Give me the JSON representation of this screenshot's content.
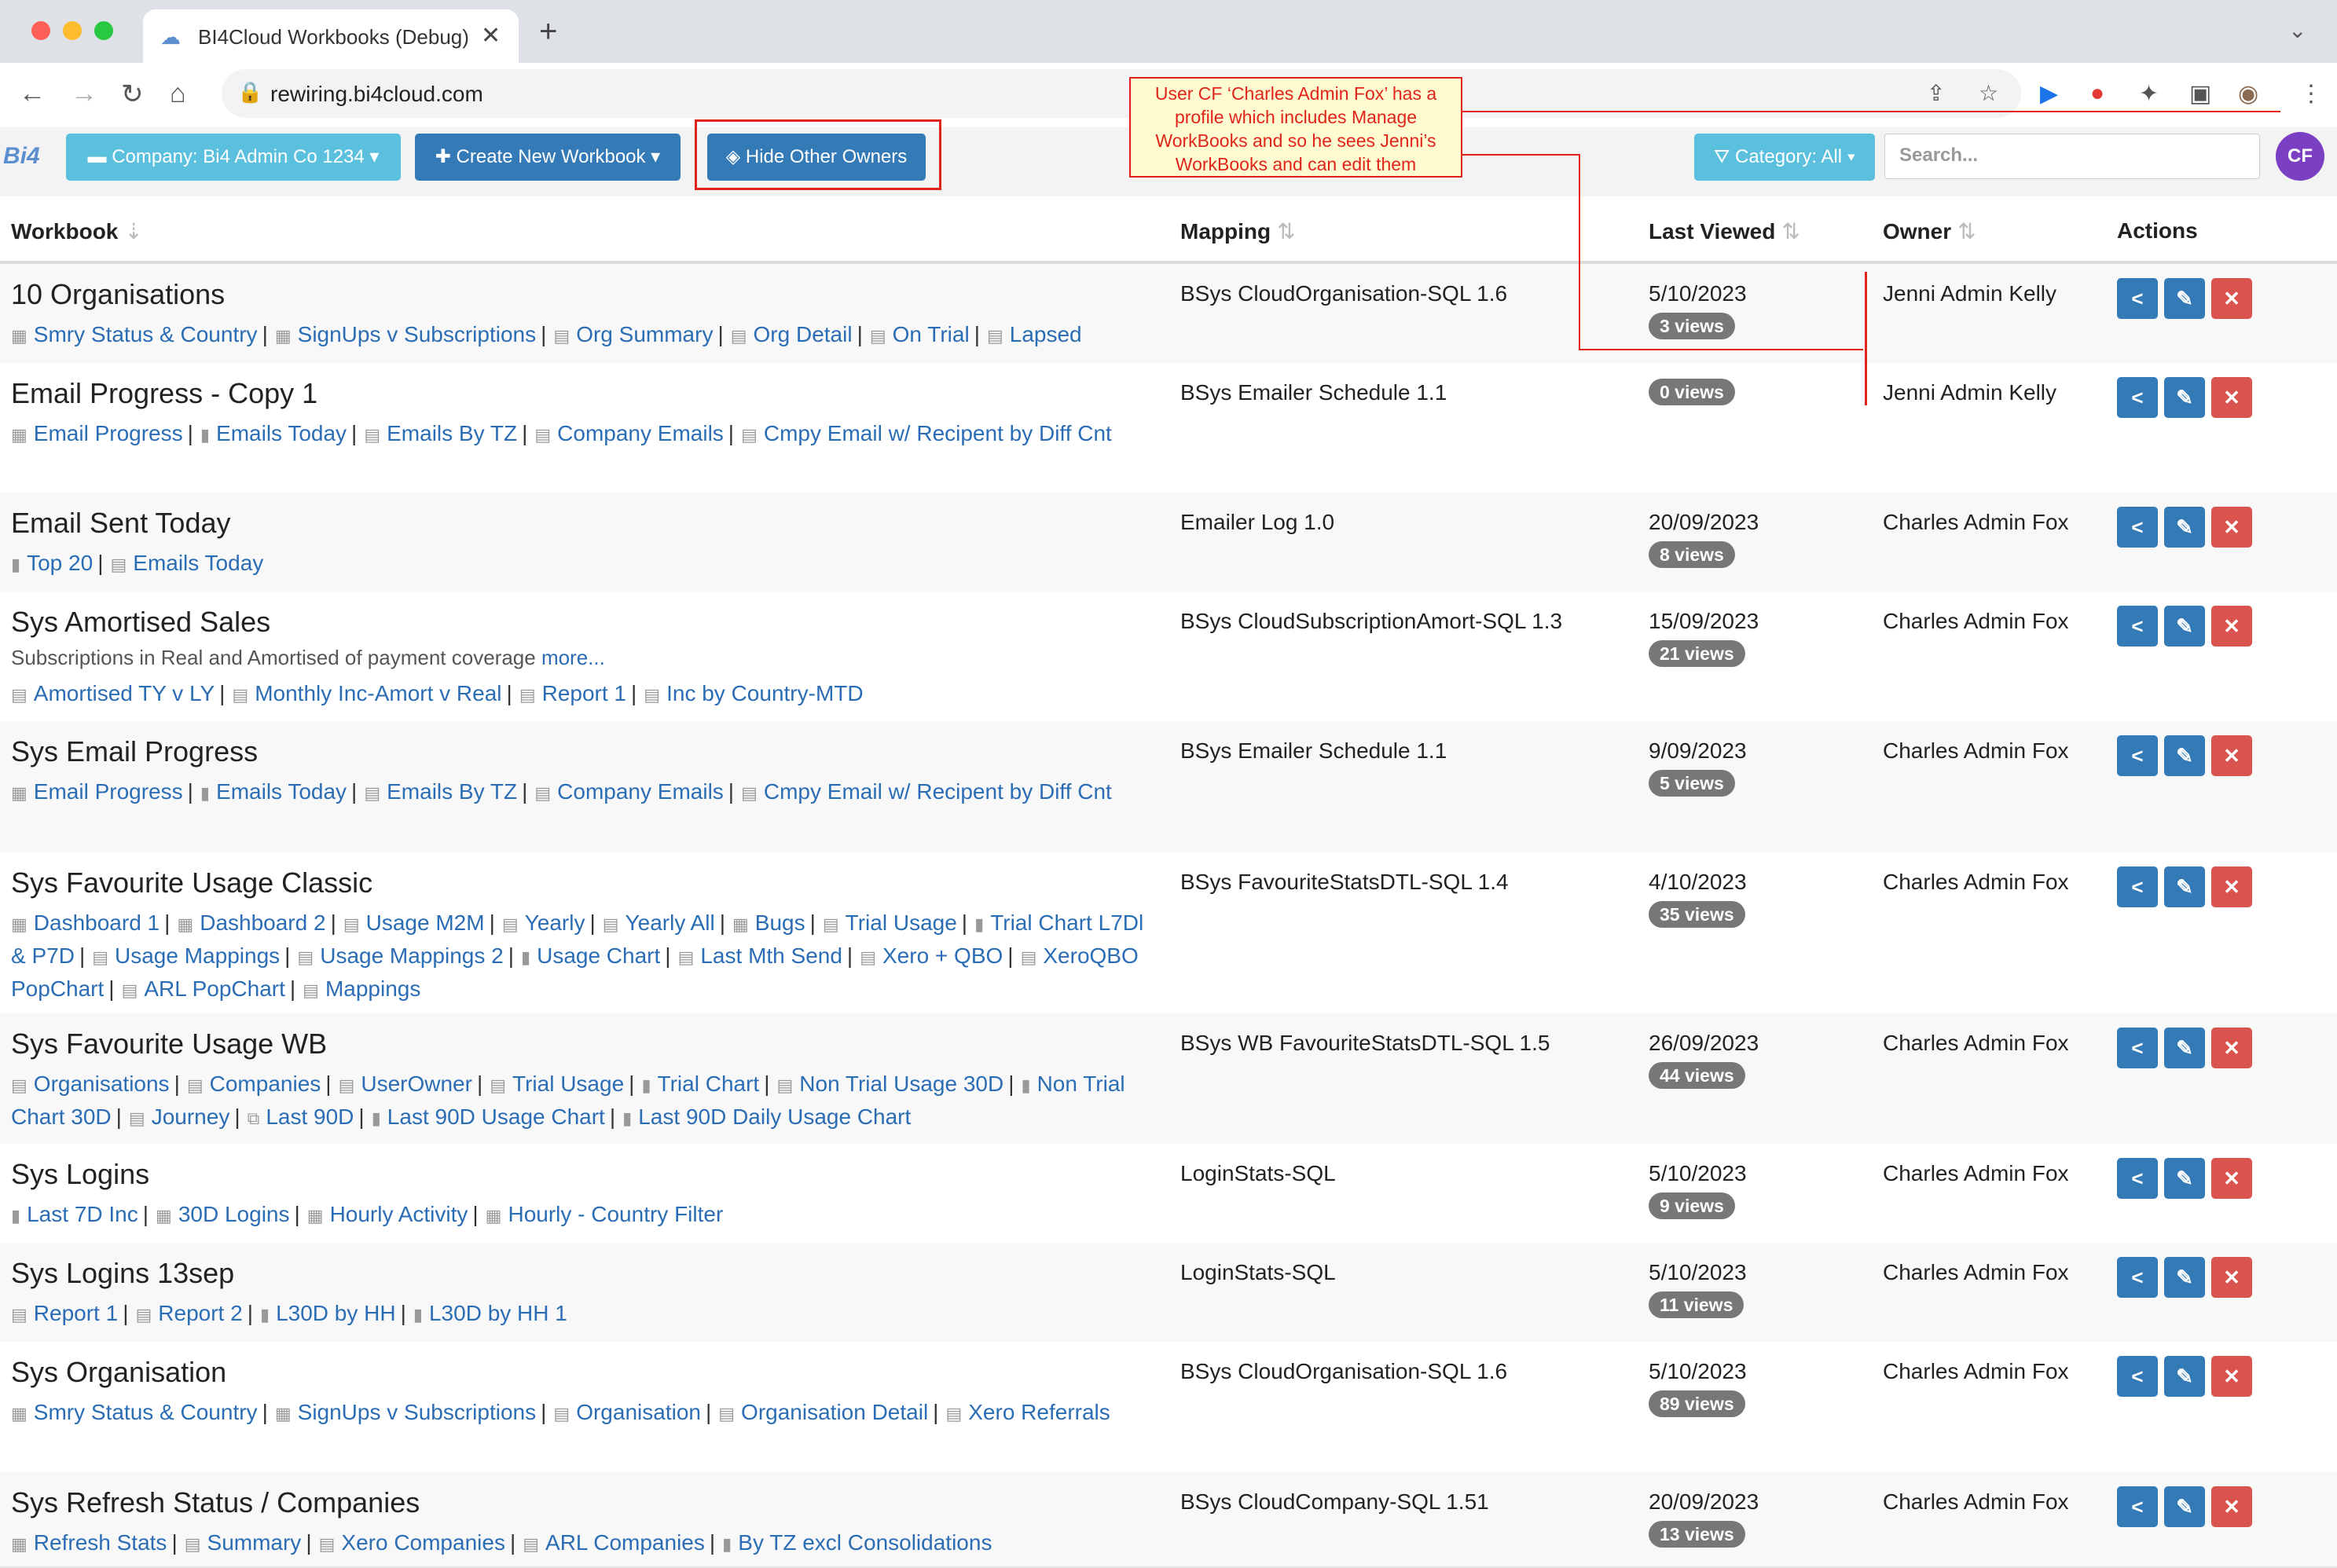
{
  "browser": {
    "tab_title": "BI4Cloud Workbooks (Debug)",
    "url": "rewiring.bi4cloud.com"
  },
  "toolbar": {
    "logo": "Bi4",
    "company_label": "Company: Bi4 Admin Co 1234",
    "create_label": "Create New Workbook",
    "hide_label": "Hide Other Owners",
    "category_label": "Category: All",
    "search_placeholder": "Search...",
    "avatar_initials": "CF"
  },
  "callout": {
    "text": "User CF ‘Charles Admin Fox’ has a profile which includes Manage WorkBooks and so he sees Jenni’s WorkBooks and can edit them"
  },
  "table": {
    "headers": {
      "workbook": "Workbook",
      "mapping": "Mapping",
      "last_viewed": "Last Viewed",
      "owner": "Owner",
      "actions": "Actions"
    },
    "rows": [
      {
        "name": "10 Organisations",
        "mapping": "BSys CloudOrganisation-SQL 1.6",
        "last_viewed": "5/10/2023",
        "views": "3 views",
        "owner": "Jenni Admin Kelly",
        "sheets": [
          {
            "t": "Smry Status & Country",
            "i": "dash"
          },
          {
            "t": "SignUps v Subscriptions",
            "i": "dash"
          },
          {
            "t": "Org Summary",
            "i": "rep"
          },
          {
            "t": "Org Detail",
            "i": "rep"
          },
          {
            "t": "On Trial",
            "i": "rep"
          },
          {
            "t": "Lapsed",
            "i": "rep"
          }
        ]
      },
      {
        "name": "Email Progress - Copy 1",
        "mapping": "BSys Emailer Schedule 1.1",
        "last_viewed": "",
        "views": "0 views",
        "owner": "Jenni Admin Kelly",
        "sheets": [
          {
            "t": "Email Progress",
            "i": "dash"
          },
          {
            "t": "Emails Today",
            "i": "chart"
          },
          {
            "t": "Emails By TZ",
            "i": "rep"
          },
          {
            "t": "Company Emails",
            "i": "rep"
          },
          {
            "t": "Cmpy Email w/ Recipent by Diff Cnt",
            "i": "rep"
          }
        ]
      },
      {
        "name": "Email Sent Today",
        "mapping": "Emailer Log 1.0",
        "last_viewed": "20/09/2023",
        "views": "8 views",
        "owner": "Charles Admin Fox",
        "sheets": [
          {
            "t": "Top 20",
            "i": "chart"
          },
          {
            "t": "Emails Today",
            "i": "rep"
          }
        ]
      },
      {
        "name": "Sys Amortised Sales",
        "desc": "Subscriptions in Real and Amortised of payment coverage",
        "desc_more": "more...",
        "mapping": "BSys CloudSubscriptionAmort-SQL 1.3",
        "last_viewed": "15/09/2023",
        "views": "21 views",
        "owner": "Charles Admin Fox",
        "sheets": [
          {
            "t": "Amortised TY v LY",
            "i": "rep"
          },
          {
            "t": "Monthly Inc-Amort v Real",
            "i": "rep"
          },
          {
            "t": "Report 1",
            "i": "rep"
          },
          {
            "t": "Inc by Country-MTD",
            "i": "rep"
          }
        ]
      },
      {
        "name": "Sys Email Progress",
        "mapping": "BSys Emailer Schedule 1.1",
        "last_viewed": "9/09/2023",
        "views": "5 views",
        "owner": "Charles Admin Fox",
        "sheets": [
          {
            "t": "Email Progress",
            "i": "dash"
          },
          {
            "t": "Emails Today",
            "i": "chart"
          },
          {
            "t": "Emails By TZ",
            "i": "rep"
          },
          {
            "t": "Company Emails",
            "i": "rep"
          },
          {
            "t": "Cmpy Email w/ Recipent by Diff Cnt",
            "i": "rep"
          }
        ]
      },
      {
        "name": "Sys Favourite Usage Classic",
        "mapping": "BSys FavouriteStatsDTL-SQL 1.4",
        "last_viewed": "4/10/2023",
        "views": "35 views",
        "owner": "Charles Admin Fox",
        "sheets": [
          {
            "t": "Dashboard 1",
            "i": "dash"
          },
          {
            "t": "Dashboard 2",
            "i": "dash"
          },
          {
            "t": "Usage M2M",
            "i": "rep"
          },
          {
            "t": "Yearly",
            "i": "rep"
          },
          {
            "t": "Yearly All",
            "i": "rep"
          },
          {
            "t": "Bugs",
            "i": "dash"
          },
          {
            "t": "Trial Usage",
            "i": "rep"
          },
          {
            "t": "Trial Chart L7Dl & P7D",
            "i": "chart"
          },
          {
            "t": "Usage Mappings",
            "i": "rep"
          },
          {
            "t": "Usage Mappings 2",
            "i": "rep"
          },
          {
            "t": "Usage Chart",
            "i": "chart"
          },
          {
            "t": "Last Mth Send",
            "i": "rep"
          },
          {
            "t": "Xero + QBO",
            "i": "rep"
          },
          {
            "t": "XeroQBO PopChart",
            "i": "rep"
          },
          {
            "t": "ARL PopChart",
            "i": "rep"
          },
          {
            "t": "Mappings",
            "i": "rep"
          }
        ]
      },
      {
        "name": "Sys Favourite Usage WB",
        "mapping": "BSys WB FavouriteStatsDTL-SQL 1.5",
        "last_viewed": "26/09/2023",
        "views": "44 views",
        "owner": "Charles Admin Fox",
        "sheets": [
          {
            "t": "Organisations",
            "i": "rep"
          },
          {
            "t": "Companies",
            "i": "rep"
          },
          {
            "t": "UserOwner",
            "i": "rep"
          },
          {
            "t": "Trial Usage",
            "i": "rep"
          },
          {
            "t": "Trial Chart",
            "i": "chart"
          },
          {
            "t": "Non Trial Usage 30D",
            "i": "rep"
          },
          {
            "t": "Non Trial Chart 30D",
            "i": "chart"
          },
          {
            "t": "Journey",
            "i": "rep"
          },
          {
            "t": "Last 90D",
            "i": "pivot"
          },
          {
            "t": "Last 90D Usage Chart",
            "i": "chart"
          },
          {
            "t": "Last 90D Daily Usage Chart",
            "i": "chart"
          }
        ]
      },
      {
        "name": "Sys Logins",
        "mapping": "LoginStats-SQL",
        "last_viewed": "5/10/2023",
        "views": "9 views",
        "owner": "Charles Admin Fox",
        "sheets": [
          {
            "t": "Last 7D Inc",
            "i": "chart"
          },
          {
            "t": "30D Logins",
            "i": "dash"
          },
          {
            "t": "Hourly Activity",
            "i": "dash"
          },
          {
            "t": "Hourly - Country Filter",
            "i": "dash"
          }
        ]
      },
      {
        "name": "Sys Logins 13sep",
        "mapping": "LoginStats-SQL",
        "last_viewed": "5/10/2023",
        "views": "11 views",
        "owner": "Charles Admin Fox",
        "sheets": [
          {
            "t": "Report 1",
            "i": "rep"
          },
          {
            "t": "Report 2",
            "i": "rep"
          },
          {
            "t": "L30D by HH",
            "i": "chart"
          },
          {
            "t": "L30D by HH 1",
            "i": "chart"
          }
        ]
      },
      {
        "name": "Sys Organisation",
        "mapping": "BSys CloudOrganisation-SQL 1.6",
        "last_viewed": "5/10/2023",
        "views": "89 views",
        "owner": "Charles Admin Fox",
        "sheets": [
          {
            "t": "Smry Status & Country",
            "i": "dash"
          },
          {
            "t": "SignUps v Subscriptions",
            "i": "dash"
          },
          {
            "t": "Organisation",
            "i": "rep"
          },
          {
            "t": "Organisation Detail",
            "i": "rep"
          },
          {
            "t": "Xero Referrals",
            "i": "rep"
          }
        ]
      },
      {
        "name": "Sys Refresh Status / Companies",
        "mapping": "BSys CloudCompany-SQL 1.51",
        "last_viewed": "20/09/2023",
        "views": "13 views",
        "owner": "Charles Admin Fox",
        "sheets": [
          {
            "t": "Refresh Stats",
            "i": "dash"
          },
          {
            "t": "Summary",
            "i": "rep"
          },
          {
            "t": "Xero Companies",
            "i": "rep"
          },
          {
            "t": "ARL Companies",
            "i": "rep"
          },
          {
            "t": "By TZ excl Consolidations",
            "i": "chart"
          }
        ]
      }
    ]
  }
}
